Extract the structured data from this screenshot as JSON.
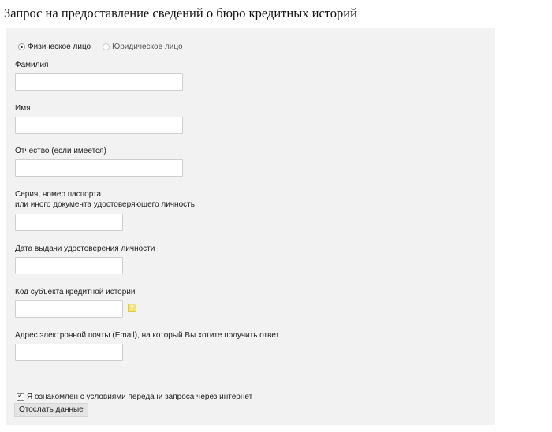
{
  "page": {
    "title": "Запрос на предоставление сведений о бюро кредитных историй"
  },
  "person_type": {
    "options": [
      "Физическое лицо",
      "Юридическое лицо"
    ],
    "selected": "Физическое лицо"
  },
  "form": {
    "fields": [
      {
        "label": "Фамилия",
        "value": ""
      },
      {
        "label": "Имя",
        "value": ""
      },
      {
        "label": "Отчество (если имеется)",
        "value": ""
      },
      {
        "label_line1": "Серия, номер паспорта",
        "label_line2": "или иного документа удостоверяющего личность",
        "value": ""
      },
      {
        "label": "Дата выдачи удостоверения личности",
        "value": ""
      },
      {
        "label": "Код субъекта кредитной истории",
        "value": "",
        "help": "?"
      },
      {
        "label": "Адрес электронной почты (Email), на который Вы хотите получить ответ",
        "value": ""
      }
    ],
    "agree_label": "Я ознакомлен с условиями передачи запроса через интернет",
    "agree_checked": true,
    "submit_label": "Отослать данные"
  },
  "colors": {
    "panel_bg": "#f2f2f2",
    "help_icon": "#f3e270"
  }
}
